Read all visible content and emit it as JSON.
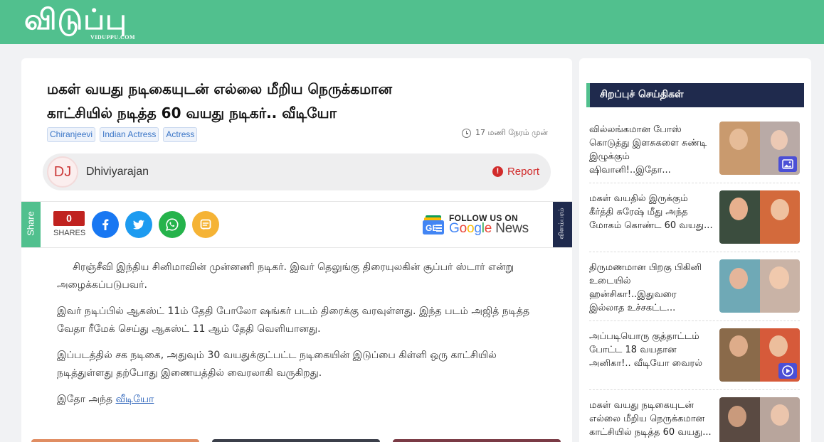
{
  "site": {
    "logo_text": "விடுப்பு",
    "logo_sub": "VIDUPPU.COM",
    "brand_color": "#51c08e",
    "navy": "#1f2a4d"
  },
  "article": {
    "title_line1": "மகள் வயது நடிகையுடன் எல்லை மீறிய நெருக்கமான",
    "title_line2": "காட்சியில் நடித்த 60 வயது நடிகர்.. வீடியோ",
    "tags": [
      "Chiranjeevi",
      "Indian Actress",
      "Actress"
    ],
    "time": "17 மணி நேரம் முன்",
    "author_initials": "DJ",
    "author_name": "Dhiviyarajan",
    "report_label": "Report",
    "paragraphs": [
      "சிரஞ்சீவி இந்திய சினிமாவின் முன்னணி நடிகர். இவர் தெலுங்கு திரையுலகின் சூப்பர் ஸ்டார் என்று அழைக்கப்படுபவர்.",
      "இவர் நடிப்பில் ஆகஸ்ட் 11ம் தேதி போலோ ஷங்கர் படம் திரைக்கு வரவுள்ளது. இந்த படம் அஜித் நடித்த வேதா ரீமேக் செய்து ஆகஸ்ட் 11 ஆம் தேதி வெளியானது.",
      "இப்படத்தில் சக நடிகை, அதுவும் 30 வயதுக்குட்பட்ட நடிகையின் இடுப்பை கிள்ளி ஒரு காட்சியில் நடித்துள்ளது தற்போது இணையத்தில் வைரலாகி வருகிறது."
    ],
    "last_prefix": "இதோ அந்த ",
    "last_link": "வீடியோ "
  },
  "share": {
    "tab_label": "Share",
    "count": "0",
    "count_label": "SHARES",
    "buttons": [
      {
        "name": "facebook",
        "color": "#1877f2"
      },
      {
        "name": "twitter",
        "color": "#1d9bf0"
      },
      {
        "name": "whatsapp",
        "color": "#25b34b"
      },
      {
        "name": "sharechat",
        "color": "#f5b335"
      }
    ],
    "gnews_follow": "FOLLOW US ON",
    "gnews_name": "Google News",
    "ad_label": "விளம்பரம்"
  },
  "sidebar": {
    "heading": "சிறப்புச் செய்திகள்",
    "items": [
      {
        "title": "வில்லங்கமான போஸ் கொடுத்து இளசுகளை சுண்டி இழுக்கும் ஷிவானி!..இதோ...",
        "badge": "gallery-icon"
      },
      {
        "title": "மகள் வயதில் இருக்கும் கீர்த்தி சுரேஷ் மீது அந்த மோகம் கொண்ட 60 வயது...",
        "badge": ""
      },
      {
        "title": "திருமணமான பிறகு பிகினி உடையில் ஹன்சிகா!..இதுவரை இல்லாத உச்சகட்ட...",
        "badge": ""
      },
      {
        "title": "அப்படியொரு குத்தாட்டம் போட்ட 18 வயதான அனிகா!.. வீடியோ வைரல்",
        "badge": "play-icon"
      },
      {
        "title": "மகள் வயது நடிகையுடன் எல்லை மீறிய நெருக்கமான காட்சியில் நடித்த 60 வயது...",
        "badge": ""
      }
    ]
  }
}
